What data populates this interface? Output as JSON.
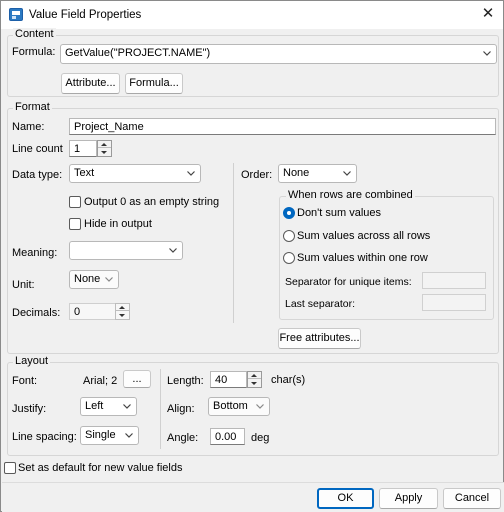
{
  "window": {
    "title": "Value Field Properties"
  },
  "content": {
    "legend": "Content",
    "formula_label": "Formula:",
    "formula_value": "GetValue(\"PROJECT.NAME\")",
    "attribute_button": "Attribute...",
    "formula_button": "Formula..."
  },
  "format": {
    "legend": "Format",
    "name_label": "Name:",
    "name_value": "Project_Name",
    "line_count_label": "Line count",
    "line_count_value": "1",
    "data_type_label": "Data type:",
    "data_type_value": "Text",
    "output_zero_label": "Output 0 as an empty string",
    "hide_output_label": "Hide in output",
    "meaning_label": "Meaning:",
    "meaning_value": "",
    "unit_label": "Unit:",
    "unit_value": "None",
    "decimals_label": "Decimals:",
    "decimals_value": "0",
    "order_label": "Order:",
    "order_value": "None",
    "combined_legend": "When rows are combined",
    "radio_dont_sum": "Don't sum values",
    "radio_sum_all": "Sum values across all rows",
    "radio_sum_one": "Sum values within one row",
    "separator_unique_label": "Separator for unique items:",
    "separator_unique_value": "",
    "last_separator_label": "Last separator:",
    "last_separator_value": "",
    "free_attributes_button": "Free attributes..."
  },
  "layout": {
    "legend": "Layout",
    "font_label": "Font:",
    "font_value": "Arial; 2",
    "font_button": "...",
    "justify_label": "Justify:",
    "justify_value": "Left",
    "line_spacing_label": "Line spacing:",
    "line_spacing_value": "Single",
    "length_label": "Length:",
    "length_value": "40",
    "length_unit": "char(s)",
    "align_label": "Align:",
    "align_value": "Bottom",
    "angle_label": "Angle:",
    "angle_value": "0.00",
    "angle_unit": "deg"
  },
  "default_checkbox_label": "Set as default for new value fields",
  "footer": {
    "ok": "OK",
    "apply": "Apply",
    "cancel": "Cancel"
  },
  "colors": {
    "accent": "#0067c0",
    "icon": "#2b79c2"
  },
  "icons": [
    "app-icon",
    "close-icon",
    "chevron-down-icon",
    "spin-up-icon",
    "spin-down-icon",
    "radio-selected-icon"
  ]
}
